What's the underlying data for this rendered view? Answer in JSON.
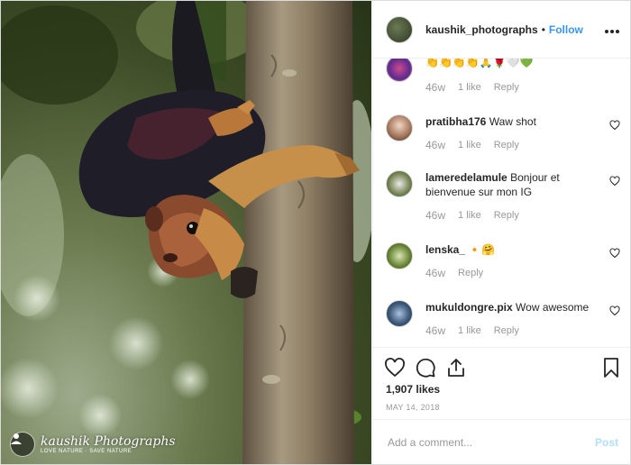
{
  "header": {
    "username": "kaushik_photographs",
    "separator": "•",
    "follow_label": "Follow",
    "more_label": "•••"
  },
  "photo": {
    "subject": "Indian giant squirrel",
    "watermark_text": "kaushik Photographs",
    "watermark_sub": "LOVE NATURE · SAVE NATURE"
  },
  "comments": [
    {
      "username": "",
      "text": "👏👏👏👏🙏🌹🤍💚",
      "age": "46w",
      "likes": "1 like",
      "reply": "Reply",
      "avatar_color": "#8b3aa8"
    },
    {
      "username": "pratibha176",
      "text": "Waw shot",
      "age": "46w",
      "likes": "1 like",
      "reply": "Reply",
      "avatar_color": "#c7a48a"
    },
    {
      "username": "lameredelamule",
      "text": "Bonjour et bienvenue sur mon IG",
      "age": "46w",
      "likes": "1 like",
      "reply": "Reply",
      "avatar_color": "#5a6a45"
    },
    {
      "username": "lenska_",
      "text": "🔸🤗",
      "age": "46w",
      "likes": "",
      "reply": "Reply",
      "avatar_color": "#6f8a3a"
    },
    {
      "username": "mukuldongre.pix",
      "text": "Wow awesome",
      "age": "46w",
      "likes": "1 like",
      "reply": "Reply",
      "avatar_color": "#3f5b7a"
    }
  ],
  "actions": {
    "icons": [
      "heart-icon",
      "comment-icon",
      "share-icon",
      "bookmark-icon"
    ]
  },
  "likes_text": "1,907 likes",
  "date_text": "MAY 14, 2018",
  "add_comment": {
    "placeholder": "Add a comment...",
    "post_label": "Post"
  },
  "colors": {
    "link_blue": "#3897f0",
    "post_disabled": "#b2dffc",
    "muted": "#999999",
    "text": "#262626"
  }
}
